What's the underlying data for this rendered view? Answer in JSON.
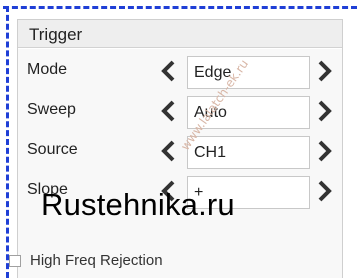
{
  "panel": {
    "title": "Trigger"
  },
  "rows": [
    {
      "label": "Mode",
      "value": "Edge"
    },
    {
      "label": "Sweep",
      "value": "Auto"
    },
    {
      "label": "Source",
      "value": "CH1"
    },
    {
      "label": "Slope",
      "value": "+"
    }
  ],
  "options": {
    "high_freq_rejection": {
      "label": "High Freq Rejection",
      "checked": false
    }
  },
  "watermark": {
    "main": "Rustehnika.ru",
    "diagonal": "www.lalatch-ek.ru"
  },
  "colors": {
    "chevron": "#333333",
    "border": "#1f3fd6"
  }
}
